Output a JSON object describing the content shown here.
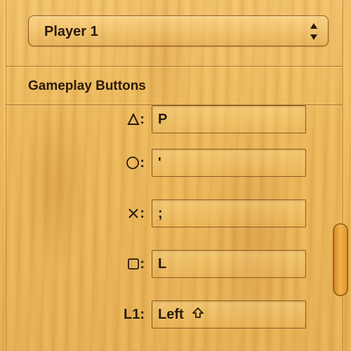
{
  "player_select": {
    "selected": "Player 1",
    "icon": "up-down-chevrons-icon"
  },
  "section": {
    "title": "Gameplay Buttons"
  },
  "buttons": [
    {
      "symbol_icon": "triangle-icon",
      "label": ":",
      "key": "P"
    },
    {
      "symbol_icon": "circle-icon",
      "label": ":",
      "key": "'"
    },
    {
      "symbol_icon": "cross-icon",
      "label": ":",
      "key": ";"
    },
    {
      "symbol_icon": "square-icon",
      "label": ":",
      "key": "L"
    },
    {
      "symbol_icon": "",
      "label": "L1:",
      "key": "Left",
      "modifier_icon": "shift-icon"
    }
  ],
  "colors": {
    "wood_light": "#f4c56d",
    "wood_dark": "#eab356",
    "text": "#2a1a0b",
    "border": "#8c5a22"
  }
}
